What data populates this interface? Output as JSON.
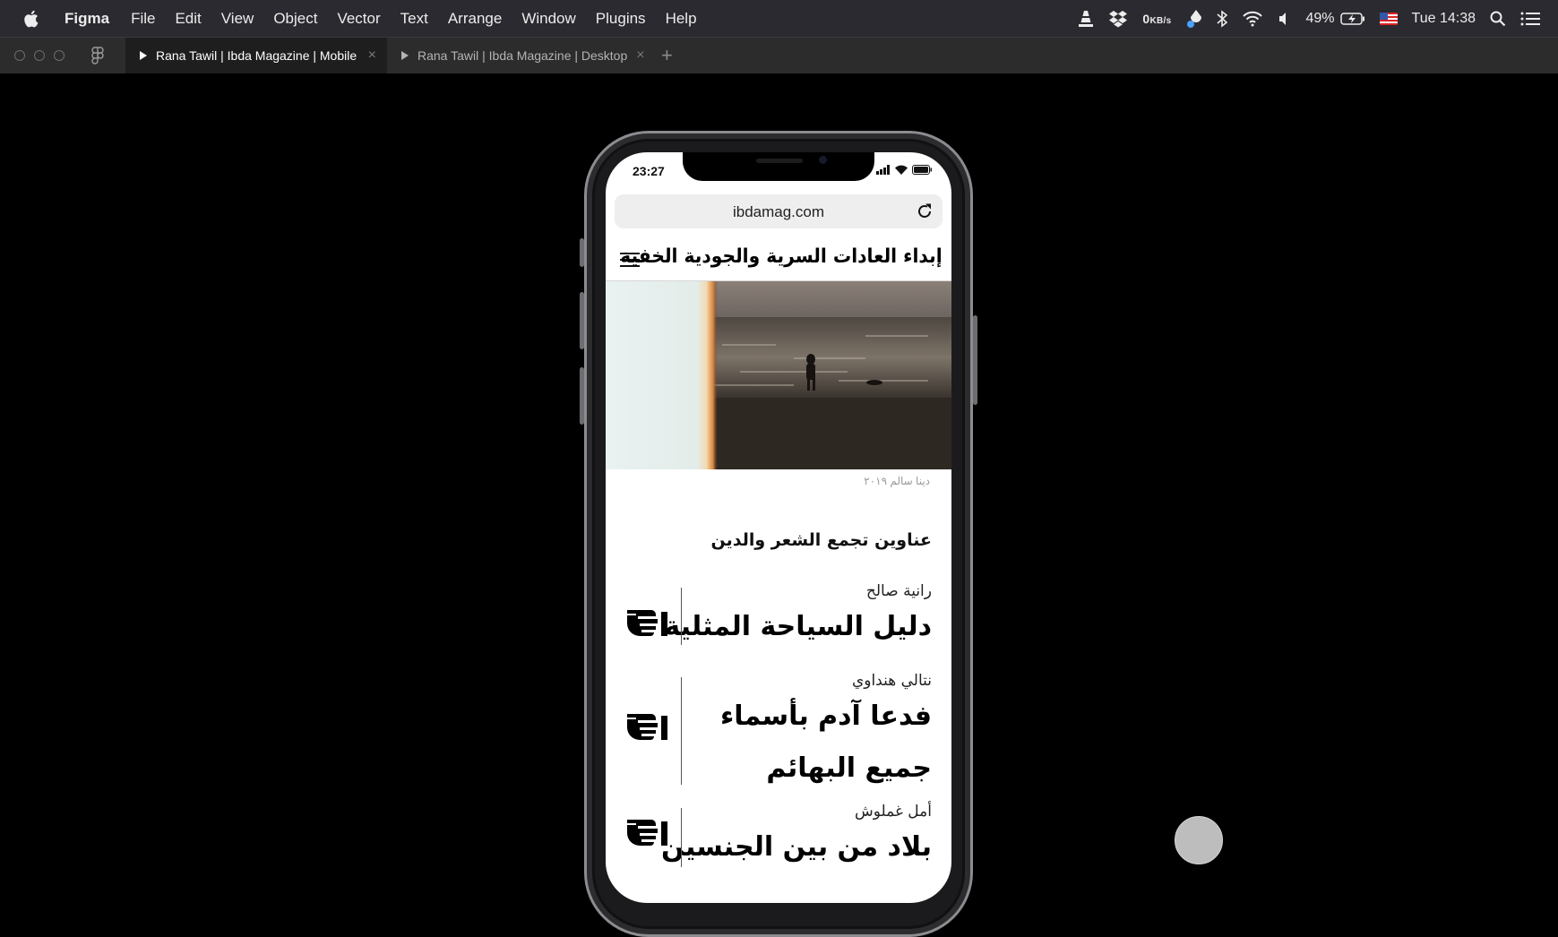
{
  "menubar": {
    "app_name": "Figma",
    "menus": [
      "File",
      "Edit",
      "View",
      "Object",
      "Vector",
      "Text",
      "Arrange",
      "Window",
      "Plugins",
      "Help"
    ],
    "network_value": "0",
    "network_unit": "KB/s",
    "battery": "49%",
    "clock": "Tue 14:38",
    "icons": [
      "apple-icon",
      "vlc-icon",
      "dropbox-icon",
      "droplet-icon",
      "bluetooth-icon",
      "wifi-icon",
      "volume-icon",
      "battery-icon",
      "us-flag-icon",
      "spotlight-icon",
      "notification-list-icon"
    ]
  },
  "tabs": [
    {
      "label": "Rana Tawil | Ibda Magazine | Mobile",
      "active": true
    },
    {
      "label": "Rana Tawil | Ibda Magazine | Desktop",
      "active": false
    }
  ],
  "tab_close_glyph": "×",
  "tab_add_glyph": "+",
  "phone": {
    "status_time": "23:27",
    "url": "ibdamag.com"
  },
  "site": {
    "title": "إبداء العادات السرية والجودية الخفية",
    "photo_caption": "دينا سالم ٢٠١٩",
    "section_title": "عناوين تجمع الشعر والدين",
    "articles": [
      {
        "author": "رانية صالح",
        "lines": [
          "دليل السياحة المثلية"
        ]
      },
      {
        "author": "نتالي هنداوي",
        "lines": [
          "فدعا آدم بأسماء",
          "جميع البهائم"
        ]
      },
      {
        "author": "أمل غملوش",
        "lines": [
          "بلاد من بين الجنسين"
        ]
      }
    ]
  },
  "colors": {
    "menubar_bg": "#2b2a30",
    "tabbar_bg": "#2c2c2c",
    "active_tab_bg": "#1e1e1e",
    "canvas_bg": "#000000",
    "cursor_dot": "#bdbdbd"
  }
}
